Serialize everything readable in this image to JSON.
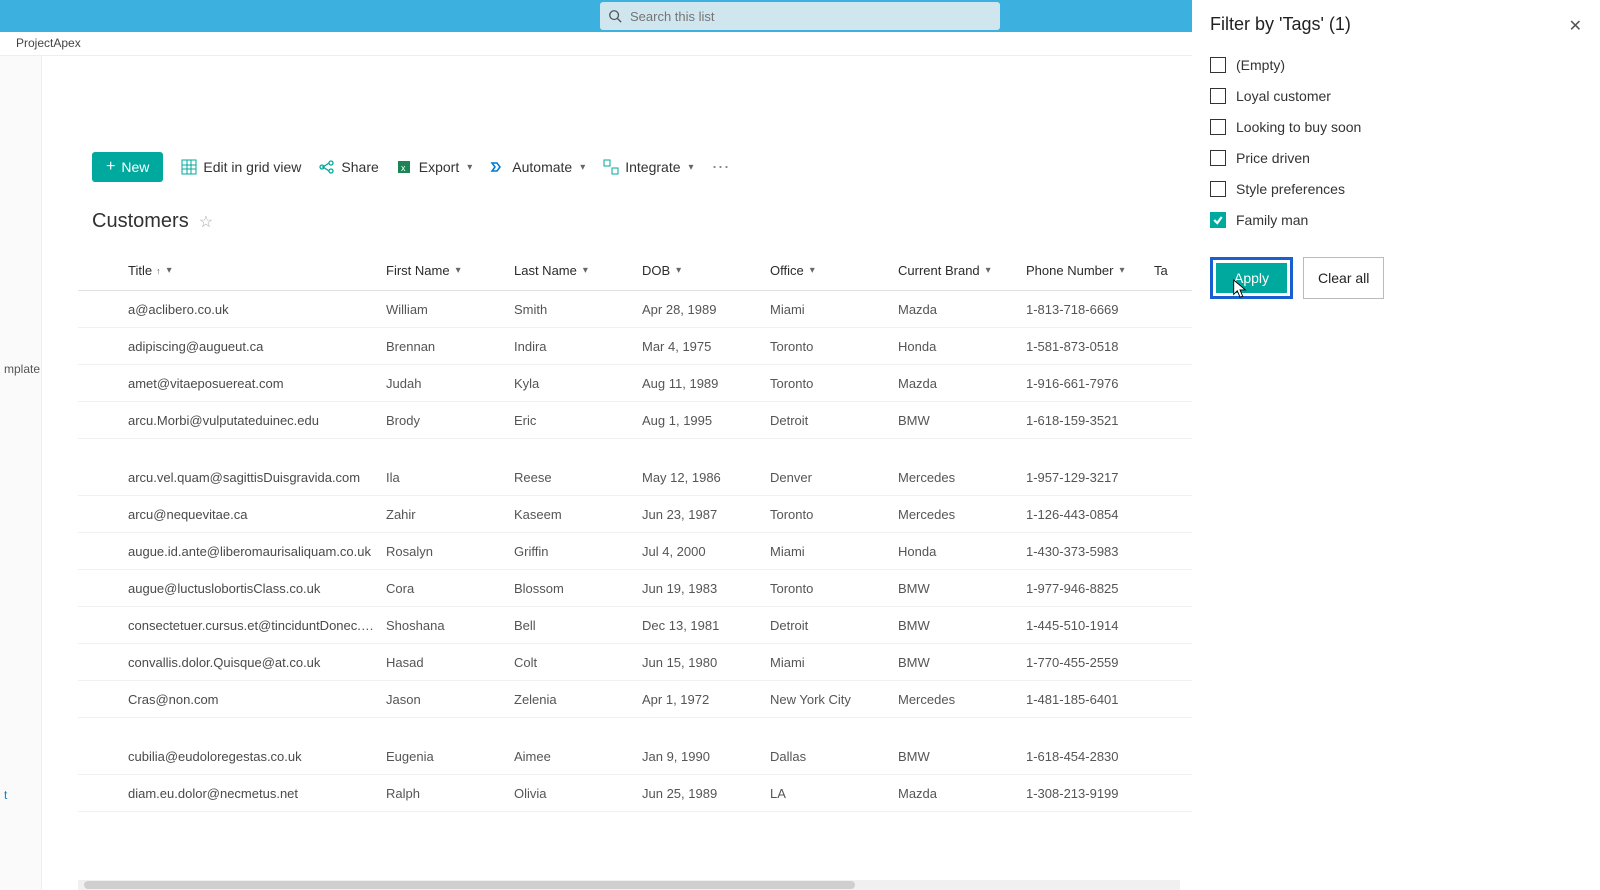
{
  "search": {
    "placeholder": "Search this list"
  },
  "breadcrumb": "ProjectApex",
  "leftnav": {
    "item1": "mplate",
    "item2": "t"
  },
  "toolbar": {
    "new": "New",
    "edit": "Edit in grid view",
    "share": "Share",
    "export": "Export",
    "automate": "Automate",
    "integrate": "Integrate"
  },
  "list": {
    "title": "Customers"
  },
  "columns": {
    "title": "Title",
    "first": "First Name",
    "last": "Last Name",
    "dob": "DOB",
    "office": "Office",
    "brand": "Current Brand",
    "phone": "Phone Number",
    "tags": "Ta"
  },
  "rows": [
    {
      "title": "a@aclibero.co.uk",
      "first": "William",
      "last": "Smith",
      "dob": "Apr 28, 1989",
      "office": "Miami",
      "brand": "Mazda",
      "phone": "1-813-718-6669"
    },
    {
      "title": "adipiscing@augueut.ca",
      "first": "Brennan",
      "last": "Indira",
      "dob": "Mar 4, 1975",
      "office": "Toronto",
      "brand": "Honda",
      "phone": "1-581-873-0518"
    },
    {
      "title": "amet@vitaeposuereat.com",
      "first": "Judah",
      "last": "Kyla",
      "dob": "Aug 11, 1989",
      "office": "Toronto",
      "brand": "Mazda",
      "phone": "1-916-661-7976"
    },
    {
      "title": "arcu.Morbi@vulputateduinec.edu",
      "first": "Brody",
      "last": "Eric",
      "dob": "Aug 1, 1995",
      "office": "Detroit",
      "brand": "BMW",
      "phone": "1-618-159-3521"
    },
    {
      "gap": true
    },
    {
      "title": "arcu.vel.quam@sagittisDuisgravida.com",
      "first": "Ila",
      "last": "Reese",
      "dob": "May 12, 1986",
      "office": "Denver",
      "brand": "Mercedes",
      "phone": "1-957-129-3217"
    },
    {
      "title": "arcu@nequevitae.ca",
      "first": "Zahir",
      "last": "Kaseem",
      "dob": "Jun 23, 1987",
      "office": "Toronto",
      "brand": "Mercedes",
      "phone": "1-126-443-0854"
    },
    {
      "title": "augue.id.ante@liberomaurisaliquam.co.uk",
      "first": "Rosalyn",
      "last": "Griffin",
      "dob": "Jul 4, 2000",
      "office": "Miami",
      "brand": "Honda",
      "phone": "1-430-373-5983"
    },
    {
      "title": "augue@luctuslobortisClass.co.uk",
      "first": "Cora",
      "last": "Blossom",
      "dob": "Jun 19, 1983",
      "office": "Toronto",
      "brand": "BMW",
      "phone": "1-977-946-8825"
    },
    {
      "title": "consectetuer.cursus.et@tinciduntDonec.co.uk",
      "first": "Shoshana",
      "last": "Bell",
      "dob": "Dec 13, 1981",
      "office": "Detroit",
      "brand": "BMW",
      "phone": "1-445-510-1914"
    },
    {
      "title": "convallis.dolor.Quisque@at.co.uk",
      "first": "Hasad",
      "last": "Colt",
      "dob": "Jun 15, 1980",
      "office": "Miami",
      "brand": "BMW",
      "phone": "1-770-455-2559"
    },
    {
      "title": "Cras@non.com",
      "first": "Jason",
      "last": "Zelenia",
      "dob": "Apr 1, 1972",
      "office": "New York City",
      "brand": "Mercedes",
      "phone": "1-481-185-6401"
    },
    {
      "gap": true
    },
    {
      "title": "cubilia@eudoloregestas.co.uk",
      "first": "Eugenia",
      "last": "Aimee",
      "dob": "Jan 9, 1990",
      "office": "Dallas",
      "brand": "BMW",
      "phone": "1-618-454-2830"
    },
    {
      "title": "diam.eu.dolor@necmetus.net",
      "first": "Ralph",
      "last": "Olivia",
      "dob": "Jun 25, 1989",
      "office": "LA",
      "brand": "Mazda",
      "phone": "1-308-213-9199"
    }
  ],
  "filter": {
    "title": "Filter by 'Tags' (1)",
    "options": [
      {
        "label": "(Empty)",
        "checked": false
      },
      {
        "label": "Loyal customer",
        "checked": false
      },
      {
        "label": "Looking to buy soon",
        "checked": false
      },
      {
        "label": "Price driven",
        "checked": false
      },
      {
        "label": "Style preferences",
        "checked": false
      },
      {
        "label": "Family man",
        "checked": true
      }
    ],
    "apply": "Apply",
    "clear": "Clear all"
  }
}
